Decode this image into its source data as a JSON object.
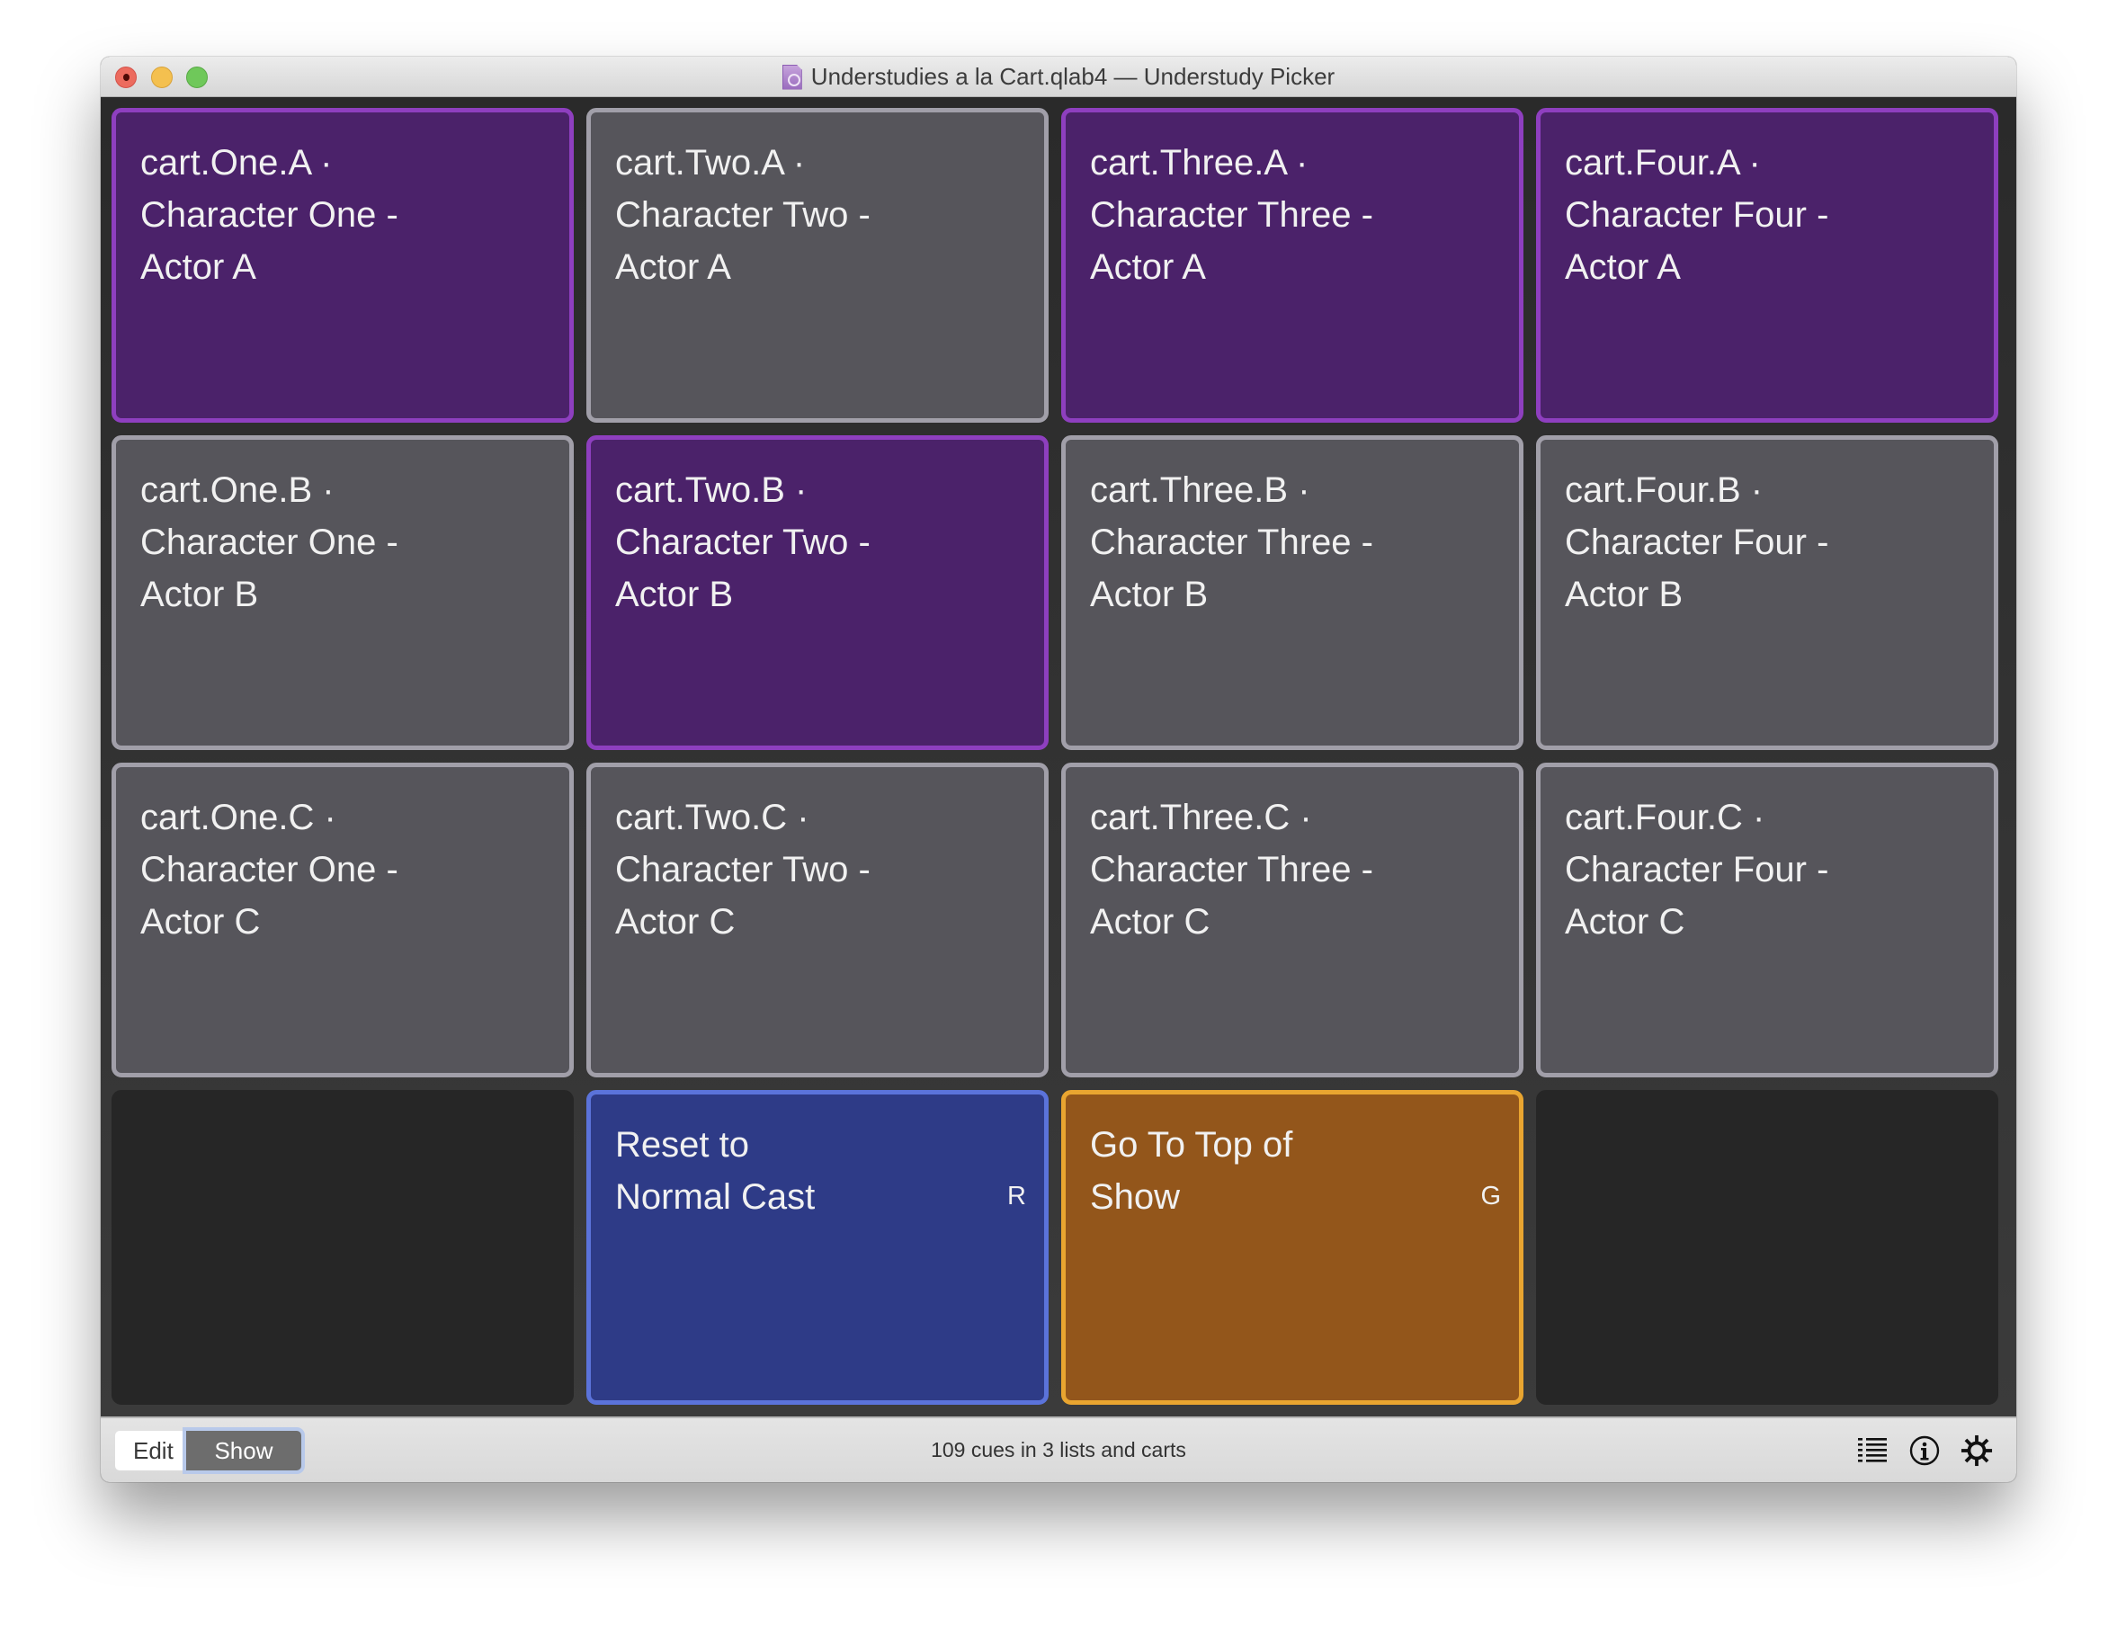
{
  "window": {
    "title": "Understudies a la Cart.qlab4 — Understudy Picker",
    "doc_icon": "qlab-document-icon",
    "traffic_lights": [
      "close",
      "minimize",
      "zoom"
    ]
  },
  "colors": {
    "purple_fill": "#4b226a",
    "purple_border": "#8e3fbf",
    "gray_fill": "#56555b",
    "gray_border": "#a19fa9",
    "blue_fill": "#2e3b87",
    "blue_border": "#5b73da",
    "orange_fill": "#93561b",
    "orange_border": "#e9a530",
    "empty_fill": "#262626"
  },
  "cart": {
    "rows": [
      [
        {
          "label": "cart.One.A ·\nCharacter One -\nActor A",
          "color": "purple"
        },
        {
          "label": "cart.Two.A ·\nCharacter Two -\nActor A",
          "color": "gray"
        },
        {
          "label": "cart.Three.A ·\nCharacter Three -\nActor A",
          "color": "purple"
        },
        {
          "label": "cart.Four.A ·\nCharacter Four -\nActor A",
          "color": "purple"
        }
      ],
      [
        {
          "label": "cart.One.B ·\nCharacter One -\nActor B",
          "color": "gray"
        },
        {
          "label": "cart.Two.B ·\nCharacter Two -\nActor B",
          "color": "purple"
        },
        {
          "label": "cart.Three.B ·\nCharacter Three -\nActor B",
          "color": "gray"
        },
        {
          "label": "cart.Four.B ·\nCharacter Four -\nActor B",
          "color": "gray"
        }
      ],
      [
        {
          "label": "cart.One.C ·\nCharacter One -\nActor C",
          "color": "gray"
        },
        {
          "label": "cart.Two.C ·\nCharacter Two -\nActor C",
          "color": "gray"
        },
        {
          "label": "cart.Three.C ·\nCharacter Three -\nActor C",
          "color": "gray"
        },
        {
          "label": "cart.Four.C ·\nCharacter Four -\nActor C",
          "color": "gray"
        }
      ],
      [
        {
          "label": "",
          "color": "empty"
        },
        {
          "label": "Reset to\nNormal Cast",
          "color": "blue",
          "hotkey": "R"
        },
        {
          "label": "Go To Top of\nShow",
          "color": "orange",
          "hotkey": "G"
        },
        {
          "label": "",
          "color": "empty"
        }
      ]
    ]
  },
  "footer": {
    "edit_label": "Edit",
    "show_label": "Show",
    "active_mode": "Show",
    "status": "109 cues in 3 lists and carts",
    "icons": [
      "list-icon",
      "info-icon",
      "gear-icon"
    ]
  }
}
